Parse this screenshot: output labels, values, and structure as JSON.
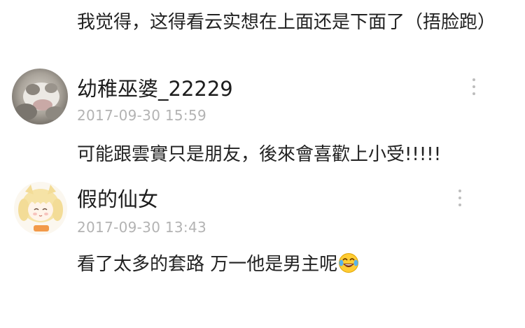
{
  "previous_comment": {
    "text": "我觉得，这得看云实想在上面还是下面了（捂脸跑）"
  },
  "comments": [
    {
      "username": "幼稚巫婆_22229",
      "timestamp": "2017-09-30 15:59",
      "text": "可能跟雲實只是朋友，後來會喜歡上小受!!!!!",
      "avatar_icon": "cat-photo-avatar",
      "more_icon": "vertical-dots-icon"
    },
    {
      "username": "假的仙女",
      "timestamp": "2017-09-30 13:43",
      "text": "看了太多的套路 万一他是男主呢",
      "emoji_icon": "tears-of-joy-emoji",
      "avatar_icon": "anime-girl-avatar",
      "more_icon": "vertical-dots-icon"
    }
  ],
  "colors": {
    "text": "#222222",
    "timestamp": "#b3b3b3",
    "more_dots": "#bdbdbd",
    "background": "#ffffff"
  }
}
